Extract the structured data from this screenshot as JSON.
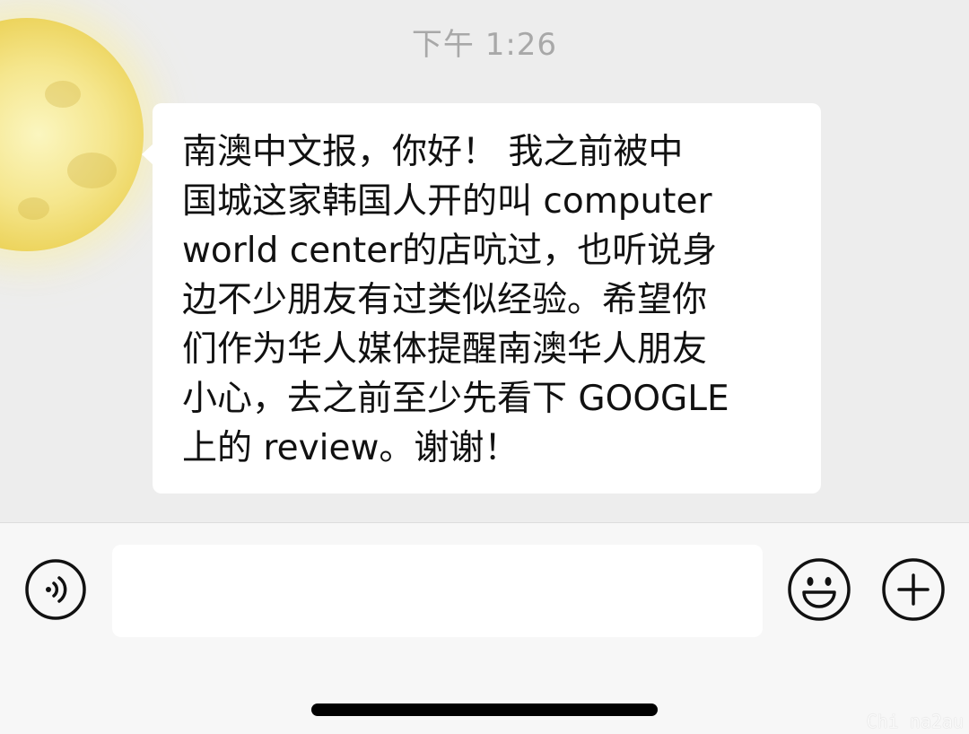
{
  "chat": {
    "timestamp": "下午 1:26",
    "message": "南澳中文报，你好！ 我之前被中\n国城这家韩国人开的叫 computer\nworld center的店吭过，也听说身\n边不少朋友有过类似经验。希望你\n们作为华人媒体提醒南澳华人朋友\n小心，去之前至少先看下 GOOGLE\n上的 review。谢谢！"
  },
  "input_bar": {
    "voice_icon": "voice-icon",
    "input_value": "",
    "emoji_icon": "emoji-icon",
    "plus_icon": "plus-icon"
  },
  "watermark": "Chi na2au",
  "colors": {
    "background": "#ededed",
    "bubble": "#ffffff",
    "input_bar": "#f7f7f7",
    "timestamp": "#a8a8a8"
  }
}
